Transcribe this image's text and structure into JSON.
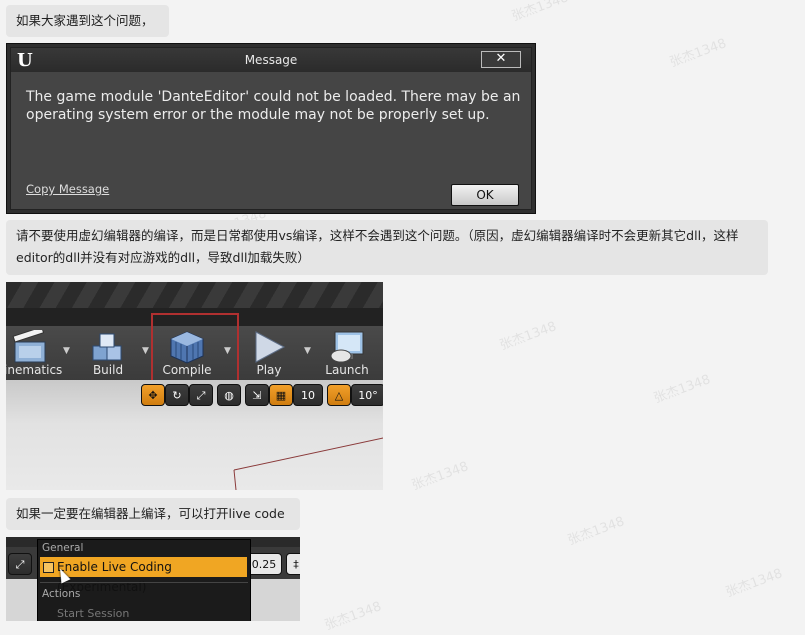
{
  "post": {
    "text1": "如果大家遇到这个问题，",
    "text2": "请不要使用虚幻编辑器的编译，而是日常都使用vs编译，这样不会遇到这个问题。（原因，虚幻编辑器编译时不会更新其它dll，这样editor的dll并没有对应游戏的dll，导致dll加载失败）",
    "text3": "如果一定要在编辑器上编译，可以打开live code",
    "watermark": "张杰1348"
  },
  "dialog": {
    "logo": "U",
    "title": "Message",
    "close": "✕",
    "message": "The game module 'DanteEditor' could not be loaded. There may be an operating system error or the module may not be properly set up.",
    "copy_message": "Copy Message",
    "ok": "OK"
  },
  "toolbar": {
    "buttons": [
      {
        "label": "Cinematics",
        "icon": "clapperboard-icon"
      },
      {
        "label": "Build",
        "icon": "build-blocks-icon"
      },
      {
        "label": "Compile",
        "icon": "compile-cube-icon"
      },
      {
        "label": "Play",
        "icon": "play-icon"
      },
      {
        "label": "Launch",
        "icon": "launch-icon"
      }
    ],
    "highlight_color": "#b03030",
    "viewport_tools": {
      "grid_snap": "10",
      "rotate_snap": "10°"
    }
  },
  "live_coding": {
    "section_general": "General",
    "enable_item": "Enable Live Coding (Experimental)",
    "section_actions": "Actions",
    "start_session": "Start Session",
    "partial_value": "0.25",
    "accent": "#f0a623"
  }
}
